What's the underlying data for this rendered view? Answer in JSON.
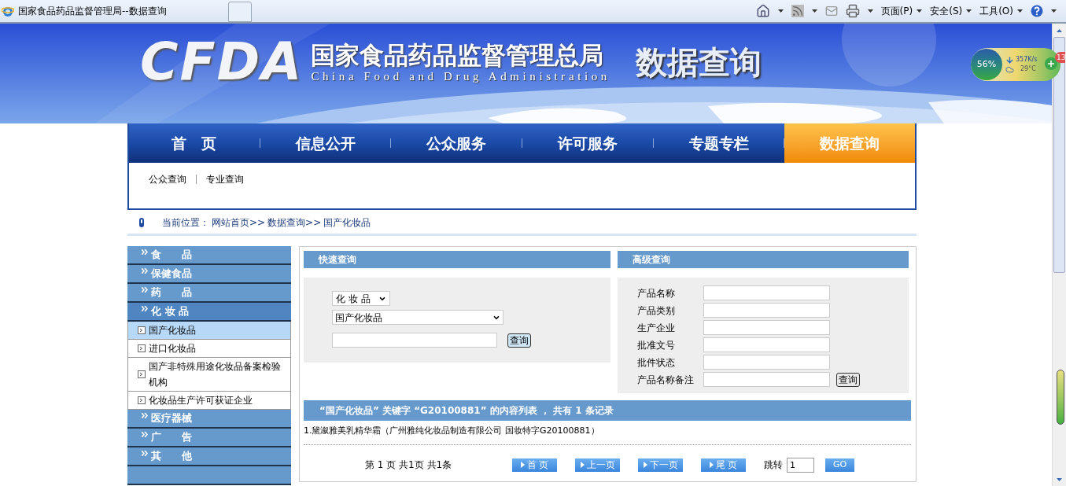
{
  "browser": {
    "tab_title": "国家食品药品监督管理局--数据查询",
    "menus": [
      "页面(P)",
      "安全(S)",
      "工具(O)"
    ]
  },
  "widget": {
    "percent": "56%",
    "speed": "357K/s",
    "temperature": "29°C",
    "badge": "13"
  },
  "header": {
    "logo": "CFDA",
    "title_cn": "国家食品药品监督管理总局",
    "title_en": "China Food and Drug Administration",
    "section": "数据查询"
  },
  "nav": [
    {
      "label": "首　页",
      "selected": false
    },
    {
      "label": "信息公开",
      "selected": false
    },
    {
      "label": "公众服务",
      "selected": false
    },
    {
      "label": "许可服务",
      "selected": false
    },
    {
      "label": "专题专栏",
      "selected": false
    },
    {
      "label": "数据查询",
      "selected": true
    }
  ],
  "subnav": [
    "公众查询",
    "专业查询"
  ],
  "breadcrumb": {
    "label": "当前位置：",
    "links": [
      "网站首页>>",
      "数据查询>>",
      "国产化妆品"
    ]
  },
  "sidebar": [
    {
      "label": "食　　品",
      "expanded": false
    },
    {
      "label": "保健食品",
      "expanded": false
    },
    {
      "label": "药　　品",
      "expanded": false
    },
    {
      "label": "化 妆 品",
      "expanded": true,
      "children": [
        {
          "label": "国产化妆品",
          "selected": true
        },
        {
          "label": "进口化妆品",
          "selected": false
        },
        {
          "label": "国产非特殊用途化妆品备案检验机构",
          "selected": false
        },
        {
          "label": "化妆品生产许可获证企业",
          "selected": false
        }
      ]
    },
    {
      "label": "医疗器械",
      "expanded": false
    },
    {
      "label": "广　　告",
      "expanded": false
    },
    {
      "label": "其　　他",
      "expanded": false
    }
  ],
  "quick_search": {
    "title": "快速查询",
    "category": "化 妆 品",
    "type": "国产化妆品",
    "button": "查询"
  },
  "advanced_search": {
    "title": "高级查询",
    "fields": [
      "产品名称",
      "产品类别",
      "生产企业",
      "批准文号",
      "批件状态",
      "产品名称备注"
    ],
    "button": "查询"
  },
  "results": {
    "heading": "“国产化妆品” 关键字 “G20100881” 的内容列表 ， 共有 1 条记录",
    "items": [
      "1.黛溆雅美乳精华霜（广州雅纯化妆品制造有限公司 国妆特字G20100881）"
    ]
  },
  "pagination": {
    "summary": "第 1 页 共1页 共1条",
    "buttons": [
      "首 页",
      "上一页",
      "下一页",
      "尾 页"
    ],
    "jump_label": "跳转",
    "jump_value": "1",
    "go": "GO"
  }
}
